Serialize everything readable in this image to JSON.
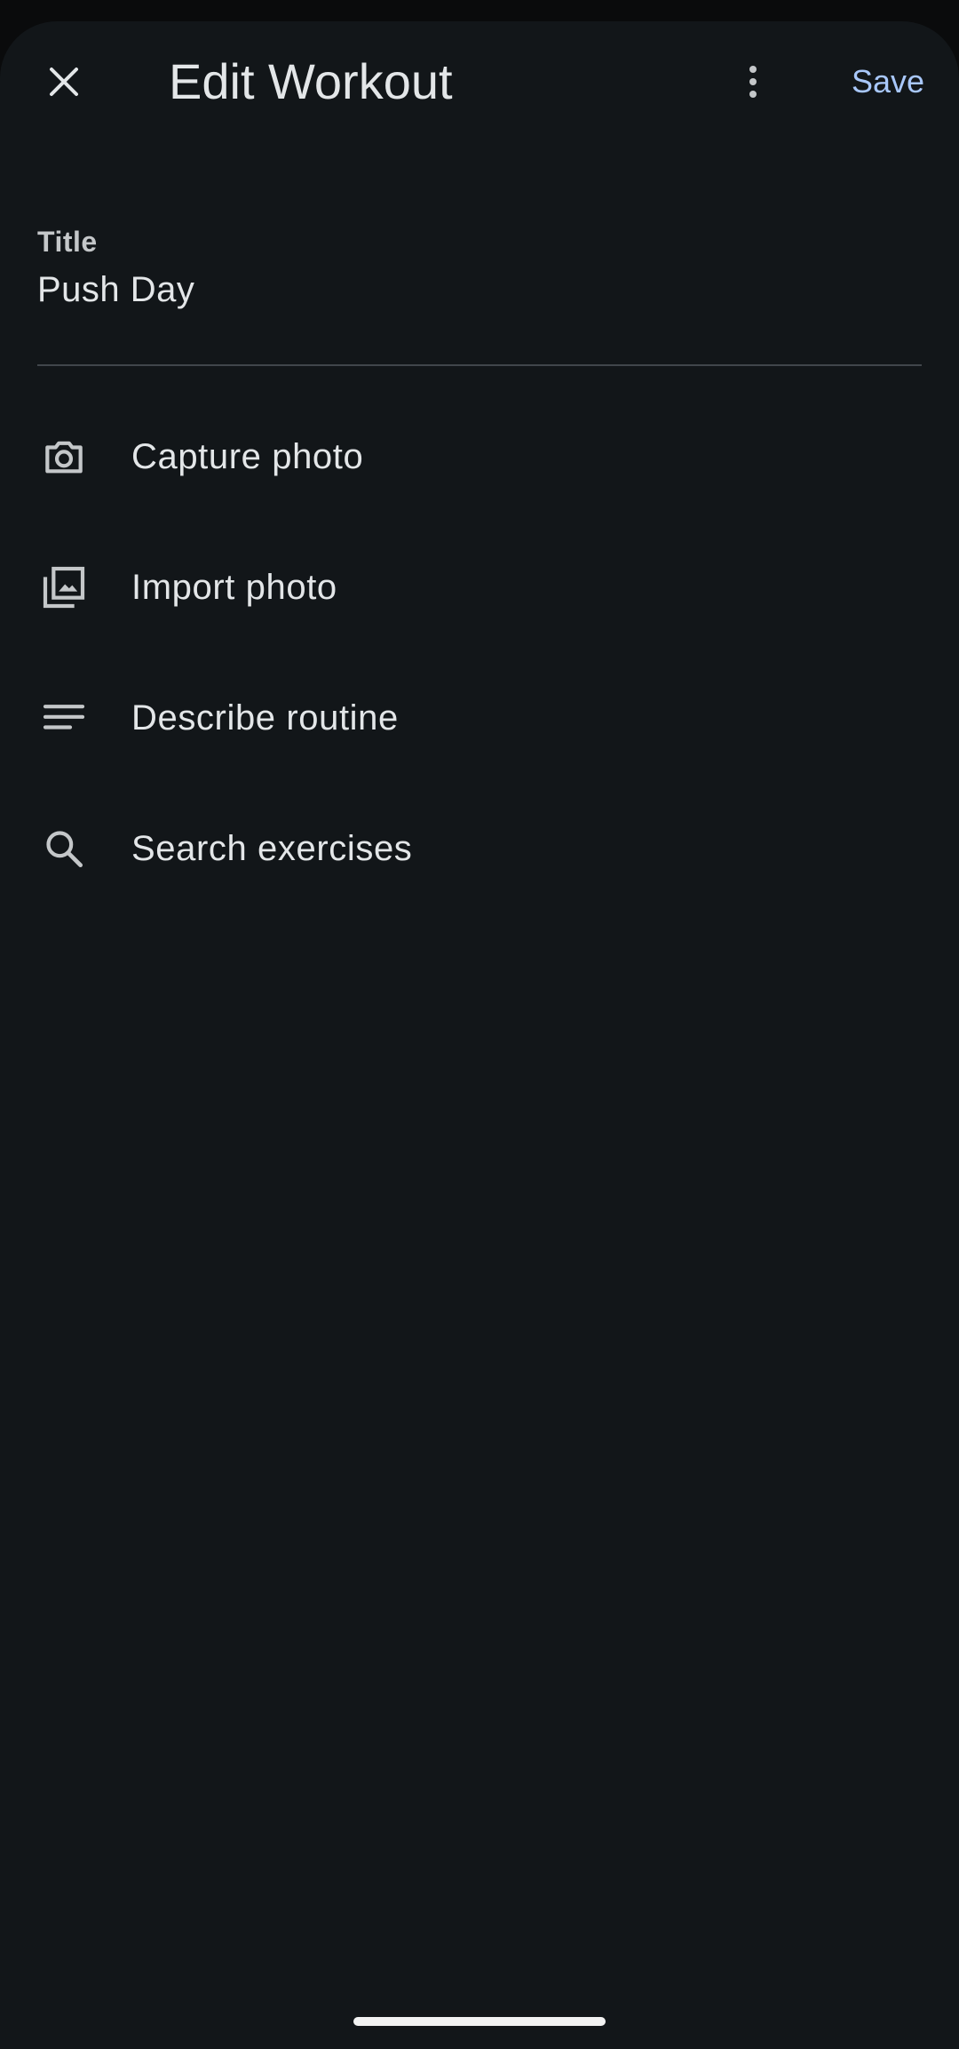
{
  "app_bar": {
    "close_icon": "close-icon",
    "title": "Edit Workout",
    "more_icon": "more-vert-icon",
    "save_label": "Save"
  },
  "title_field": {
    "label": "Title",
    "value": "Push Day"
  },
  "options": [
    {
      "icon": "camera-icon",
      "label": "Capture photo"
    },
    {
      "icon": "photo-library-icon",
      "label": "Import photo"
    },
    {
      "icon": "notes-icon",
      "label": "Describe routine"
    },
    {
      "icon": "search-icon",
      "label": "Search exercises"
    }
  ],
  "colors": {
    "background": "#121619",
    "text": "#e3e6e8",
    "accent": "#a8c7fa",
    "icon": "#c4c7c9",
    "divider": "#41464b"
  }
}
